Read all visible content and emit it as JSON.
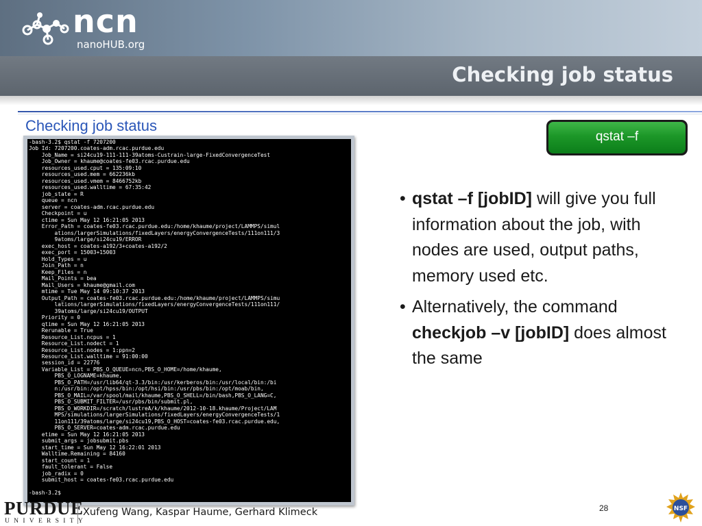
{
  "header": {
    "logo_main": "ncn",
    "logo_sub": "nanoHUB.org",
    "title": "Checking job status"
  },
  "slide": {
    "subtitle": "Checking job status",
    "command_button": "qstat –f",
    "page_number": "28"
  },
  "terminal": {
    "lines": [
      "-bash-3.2$ qstat -f 7207200",
      "Job Id: 7207200.coates-adm.rcac.purdue.edu",
      "    Job_Name = si24cu19-111-111-39atoms-Custrain-large-FixedConvergenceTest",
      "    Job_Owner = khaume@coates-fe03.rcac.purdue.edu",
      "    resources_used.cput = 135:09:10",
      "    resources_used.mem = 662236kb",
      "    resources_used.vmem = 8466752kb",
      "    resources_used.walltime = 67:35:42",
      "    job_state = R",
      "    queue = ncn",
      "    server = coates-adm.rcac.purdue.edu",
      "    Checkpoint = u",
      "    ctime = Sun May 12 16:21:05 2013",
      "    Error_Path = coates-fe03.rcac.purdue.edu:/home/khaume/project/LAMMPS/simul",
      "        ations/largerSimulations/fixedLayers/energyConvergenceTests/111on111/3",
      "        9atoms/large/si24cu19/ERROR",
      "    exec_host = coates-a192/3+coates-a192/2",
      "    exec_port = 15003+15003",
      "    Hold_Types = u",
      "    Join_Path = n",
      "    Keep_Files = n",
      "    Mail_Points = bea",
      "    Mail_Users = khaume@gmail.com",
      "    mtime = Tue May 14 09:10:37 2013",
      "    Output_Path = coates-fe03.rcac.purdue.edu:/home/khaume/project/LAMMPS/simu",
      "        lations/largerSimulations/fixedLayers/energyConvergenceTests/111on111/",
      "        39atoms/large/si24cu19/OUTPUT",
      "    Priority = 0",
      "    qtime = Sun May 12 16:21:05 2013",
      "    Rerunable = True",
      "    Resource_List.ncpus = 1",
      "    Resource_List.nodect = 1",
      "    Resource_List.nodes = 1:ppn=2",
      "    Resource_List.walltime = 91:00:00",
      "    session_id = 22776",
      "    Variable_List = PBS_O_QUEUE=ncn,PBS_O_HOME=/home/khaume,",
      "        PBS_O_LOGNAME=khaume,",
      "        PBS_O_PATH=/usr/lib64/qt-3.3/bin:/usr/kerberos/bin:/usr/local/bin:/bi",
      "        n:/usr/bin:/opt/hpss/bin:/opt/hsi/bin:/usr/pbs/bin:/opt/moab/bin,",
      "        PBS_O_MAIL=/var/spool/mail/khaume,PBS_O_SHELL=/bin/bash,PBS_O_LANG=C,",
      "        PBS_O_SUBMIT_FILTER=/usr/pbs/bin/submit.pl,",
      "        PBS_O_WORKDIR=/scratch/lustreA/k/khaume/2012-10-18.khaume/Project/LAM",
      "        MPS/simulations/largerSimulations/fixedLayers/energyConvergenceTests/1",
      "        11on111/39atoms/large/si24cu19,PBS_O_HOST=coates-fe03.rcac.purdue.edu,",
      "        PBS_O_SERVER=coates-adm.rcac.purdue.edu",
      "    etime = Sun May 12 16:21:05 2013",
      "    submit_args = jobsubmit.pbs",
      "    start_time = Sun May 12 16:22:01 2013",
      "    Walltime.Remaining = 84160",
      "    start_count = 1",
      "    fault_tolerant = False",
      "    job_radix = 0",
      "    submit_host = coates-fe03.rcac.purdue.edu",
      "",
      "-bash-3.2$"
    ]
  },
  "bullets": [
    {
      "dot": "•",
      "bold": "qstat –f [jobID]",
      "text": " will give you full information about the job, with nodes are used, output paths, memory used etc."
    },
    {
      "dot": "•",
      "text": "Alternatively, the command ",
      "bold": "checkjob –v [jobID]",
      "text_after": " does almost the same"
    }
  ],
  "footer": {
    "institution": "PURDUE",
    "institution_sub": "UNIVERSITY",
    "authors": "Xufeng Wang, Kaspar Haume, Gerhard Klimeck",
    "nsf_label": "NSF"
  },
  "icons": {
    "logo": "molecule-logo-icon",
    "nsf": "nsf-seal-icon"
  },
  "colors": {
    "subtitle": "#2a56b8",
    "button_green": "#1c9728",
    "title_bar": "#5c646d",
    "rule": "#3355aa"
  }
}
